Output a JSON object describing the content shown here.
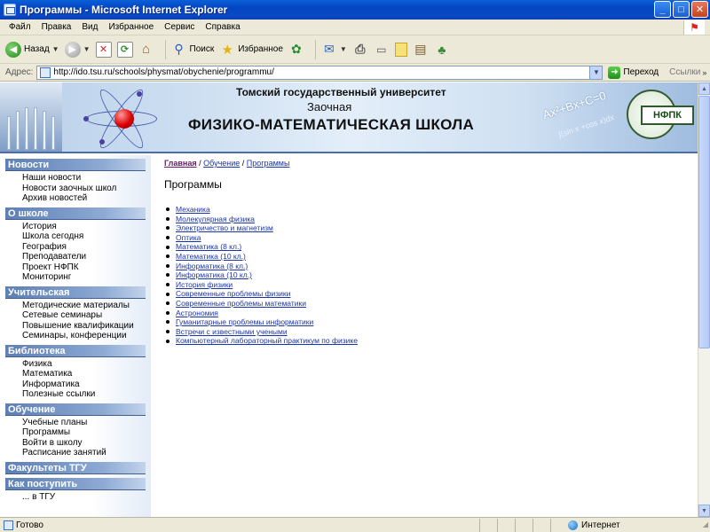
{
  "window": {
    "title": "Программы - Microsoft Internet Explorer",
    "minimize": "_",
    "maximize": "□",
    "close": "✕"
  },
  "menu": [
    "Файл",
    "Правка",
    "Вид",
    "Избранное",
    "Сервис",
    "Справка"
  ],
  "toolbar": {
    "back_label": "Назад",
    "search_label": "Поиск",
    "favorites_label": "Избранное",
    "icons": [
      "back-icon",
      "forward-icon",
      "stop-icon",
      "refresh-icon",
      "home-icon",
      "search-icon",
      "favorites-icon",
      "media-icon",
      "mail-icon",
      "print-icon",
      "edit-icon",
      "discuss-icon",
      "research-icon",
      "messenger-icon"
    ]
  },
  "address": {
    "label": "Адрес:",
    "url": "http://ido.tsu.ru/schools/physmat/obychenie/programmu/",
    "go_label": "Переход",
    "links_label": "Ссылки"
  },
  "banner": {
    "line1": "Томский государственный университет",
    "line2": "Заочная",
    "line3": "ФИЗИКО-МАТЕМАТИЧЕСКАЯ ШКОЛА",
    "formula": "Ax²+Bx+C=0",
    "formula2": "∫(sin x +cos x)dx",
    "logo_text": "НФПК"
  },
  "sidebar": [
    {
      "title": "Новости",
      "items": [
        "Наши новости",
        "Новости заочных школ",
        "Архив новостей"
      ]
    },
    {
      "title": "О школе",
      "items": [
        "История",
        "Школа сегодня",
        "География",
        "Преподаватели",
        "Проект НФПК",
        "Мониторинг"
      ]
    },
    {
      "title": "Учительская",
      "items": [
        "Методические материалы",
        "Сетевые семинары",
        "Повышение квалификации",
        "Семинары, конференции"
      ]
    },
    {
      "title": "Библиотека",
      "items": [
        "Физика",
        "Математика",
        "Информатика",
        "Полезные ссылки"
      ]
    },
    {
      "title": "Обучение",
      "items": [
        "Учебные планы",
        "Программы",
        "Войти в школу",
        "Расписание занятий"
      ]
    },
    {
      "title": "Факультеты ТГУ",
      "items": []
    },
    {
      "title": "Как поступить",
      "items": [
        "... в ТГУ"
      ]
    }
  ],
  "breadcrumb": {
    "home": "Главная",
    "sep": " / ",
    "level1": "Обучение",
    "level2": "Программы"
  },
  "page_heading": "Программы",
  "programs": [
    "Механика",
    "Молекулярная физика",
    "Электричество и магнетизм",
    "Оптика",
    "Математика (8 кл.)",
    "Математика (10 кл.)",
    "Информатика (8 кл.)",
    "Информатика (10 кл.)",
    "История физики",
    "Современные проблемы физики",
    "Современные проблемы математики",
    "Астрономия",
    "Гуманитарные проблемы информатики",
    "Встречи с известными учеными",
    "Компьютерный лабораторный практикум по физике"
  ],
  "status": {
    "text": "Готово",
    "zone": "Интернет"
  }
}
